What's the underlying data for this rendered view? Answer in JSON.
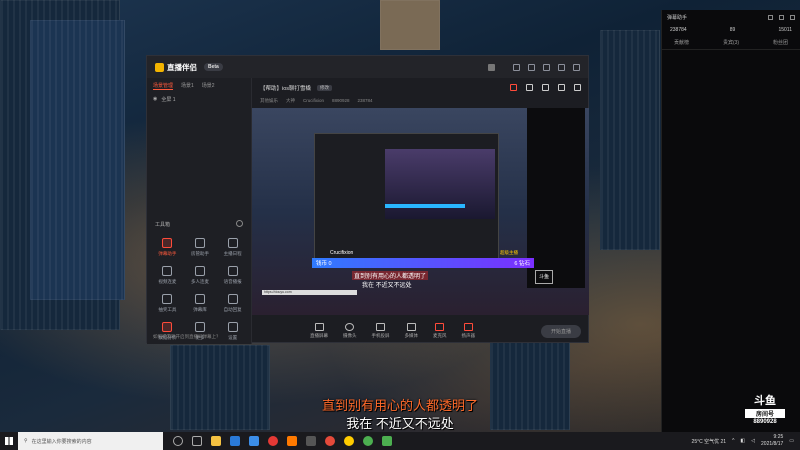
{
  "app": {
    "logo": "直播伴侣",
    "logo_pill": "Beta",
    "scene_tabs": [
      "场景管理",
      "场景1",
      "场景2"
    ],
    "scene_item": "全屏 1",
    "tools_title": "工具箱",
    "tools": [
      {
        "label": "弹幕助手",
        "accent": true
      },
      {
        "label": "房管助手",
        "accent": false
      },
      {
        "label": "主播日程",
        "accent": false
      },
      {
        "label": "视频连麦",
        "accent": false
      },
      {
        "label": "多人连麦",
        "accent": false
      },
      {
        "label": "语音播报",
        "accent": false
      },
      {
        "label": "抽奖工具",
        "accent": false
      },
      {
        "label": "弹幕库",
        "accent": false
      },
      {
        "label": "自动回复",
        "accent": false
      },
      {
        "label": "数据分析",
        "accent": false
      },
      {
        "label": "更多",
        "accent": false
      },
      {
        "label": "设置",
        "accent": false
      }
    ],
    "left_hint": "如何把游戏开启到直播间弹幕上？",
    "room": {
      "title": "【帮助】ios聊打雪橇",
      "tag": "修改",
      "sub_items": [
        "其他娱乐",
        "大神",
        "Crucifixion",
        "8890928",
        "238784"
      ]
    },
    "preview": {
      "danmu_name": "Crucifixion",
      "danmu_badge": "超级主播",
      "gift_left": "钱币 0",
      "gift_right": "6 钻石",
      "danmu_line1": "直到别有用心的人都透明了",
      "danmu_line2": "我在 不近又不远处",
      "url": "https://douyu.com",
      "mini_logo": "斗鱼"
    },
    "bottom_bar": [
      "直播屏幕",
      "摄像头",
      "手机投屏",
      "多媒体",
      "麦克风",
      "扬声器"
    ],
    "go_live": "开始直播"
  },
  "side_panel": {
    "title": "弹幕助手",
    "stats": [
      "238784",
      "89",
      "15011"
    ],
    "tabs": [
      "贡献榜",
      "贵宾(3)",
      "粉丝团"
    ]
  },
  "subtitles": {
    "line1": "直到别有用心的人都透明了",
    "line2": "我在 不近又不远处"
  },
  "watermark": {
    "logo": "斗鱼",
    "sub": "房间号",
    "id": "8890928"
  },
  "taskbar": {
    "search_placeholder": "在这里输入你要搜索的内容",
    "weather": "25°C 空气优 21",
    "time": "9:25",
    "date": "2021/8/17"
  }
}
